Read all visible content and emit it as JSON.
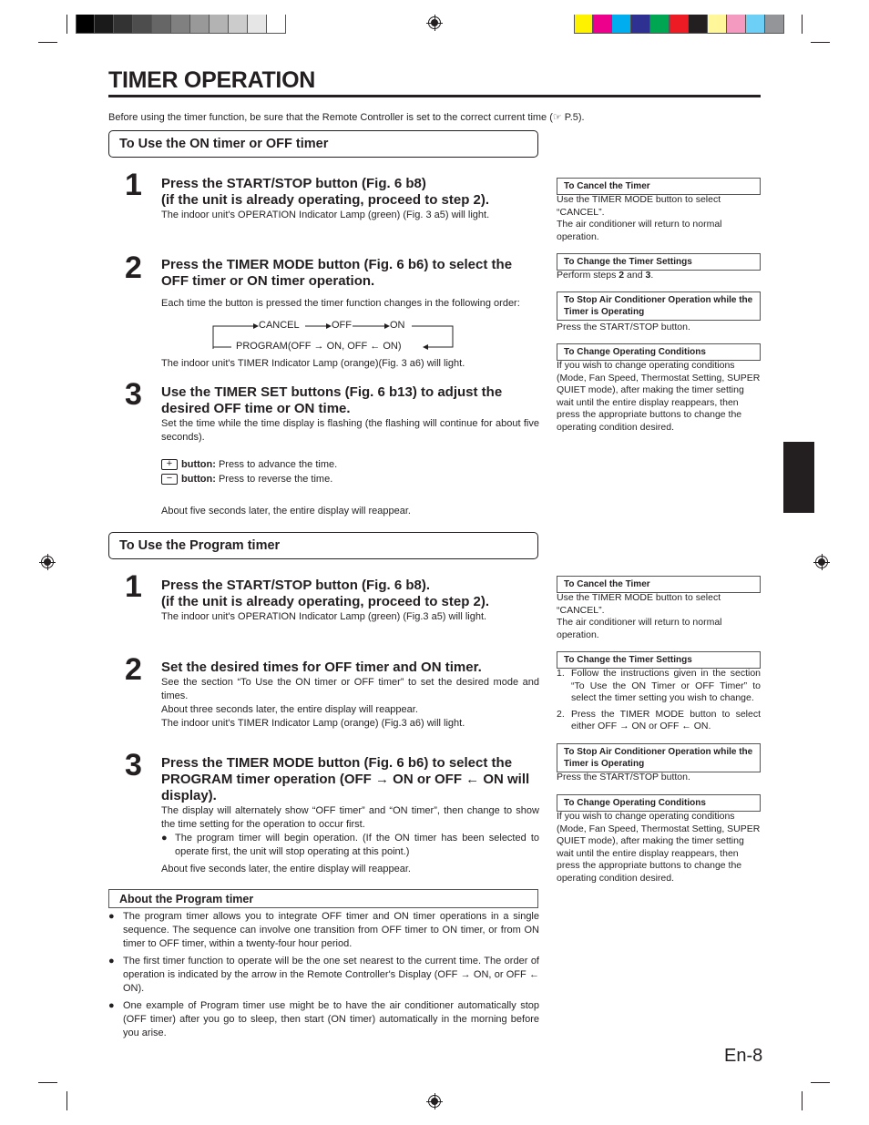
{
  "print_marks": {
    "grayscale_swatches": [
      "#000000",
      "#1a1a1a",
      "#333333",
      "#4d4d4d",
      "#666666",
      "#808080",
      "#999999",
      "#b3b3b3",
      "#cccccc",
      "#e6e6e6",
      "#ffffff"
    ],
    "color_swatches": [
      "#fff200",
      "#ec008c",
      "#00aeef",
      "#2e3192",
      "#00a651",
      "#ed1c24",
      "#231f20",
      "#fff799",
      "#f49ac1",
      "#6dcff6",
      "#939598"
    ]
  },
  "page": {
    "title": "TIMER OPERATION",
    "intro": "Before using the timer function, be sure that the Remote Controller is set to the correct current time (☞ P.5).",
    "page_number": "En-8"
  },
  "section1": {
    "heading": "To Use the ON timer or OFF timer",
    "steps": [
      {
        "num": "1",
        "head": "Press the START/STOP button (Fig. 6 b8) (if the unit is already operating, proceed to step 2).",
        "head_line1": "Press the START/STOP button (Fig. 6 b8)",
        "head_line2": "(if the unit is already operating, proceed to step 2).",
        "body": "The indoor unit's OPERATION Indicator Lamp (green) (Fig. 3 a5) will light."
      },
      {
        "num": "2",
        "head": "Press the TIMER MODE button (Fig. 6 b6) to select the OFF timer or ON timer operation.",
        "body": "Each time the button is pressed the timer function changes in the following order:",
        "flow": {
          "cancel": "CANCEL",
          "off": "OFF",
          "on": "ON",
          "program": "PROGRAM(OFF → ON, OFF ← ON)"
        },
        "body2": "The indoor unit's TIMER Indicator Lamp (orange)(Fig. 3 a6) will light."
      },
      {
        "num": "3",
        "head": "Use the TIMER SET buttons (Fig. 6 b13) to adjust the desired OFF time or ON time.",
        "body": "Set the time while the time display is flashing (the flashing will continue for about five seconds).",
        "plus_key": "+",
        "plus_label": "button:",
        "plus_text": "Press to advance the time.",
        "minus_key": "−",
        "minus_label": "button:",
        "minus_text": "Press to reverse the time.",
        "body2": "About five seconds later, the entire display will reappear."
      }
    ],
    "sidebar": [
      {
        "heading": "To Cancel the Timer",
        "text": "Use the TIMER MODE button to select “CANCEL”.\nThe air conditioner will return to normal operation."
      },
      {
        "heading": "To Change the Timer Settings",
        "text_pre": "Perform steps ",
        "b1": "2",
        "mid": " and ",
        "b2": "3",
        "post": "."
      },
      {
        "heading": "To Stop Air Conditioner Operation while the Timer is Operating",
        "text": "Press the START/STOP button."
      },
      {
        "heading": "To Change Operating Conditions",
        "text": "If you wish to change operating conditions (Mode, Fan Speed, Thermostat Setting, SUPER QUIET mode), after making the timer setting wait until the entire display reappears, then press the appropriate buttons to change the operating condition desired."
      }
    ]
  },
  "section2": {
    "heading": "To Use the Program timer",
    "steps": [
      {
        "num": "1",
        "head_line1": "Press the START/STOP button (Fig. 6 b8).",
        "head_line2": "(if the unit is already operating, proceed to step 2).",
        "body": "The indoor unit's OPERATION Indicator Lamp (green) (Fig.3 a5) will light."
      },
      {
        "num": "2",
        "head": "Set the desired times for OFF timer and ON timer.",
        "body": "See the section “To Use the ON timer or OFF timer” to set the desired mode and times.",
        "body2": "About three seconds later, the entire display will reappear.",
        "body3": "The indoor unit's TIMER Indicator Lamp (orange) (Fig.3 a6) will light."
      },
      {
        "num": "3",
        "head": "Press the TIMER MODE button (Fig. 6 b6) to select the PROGRAM timer operation (OFF → ON or OFF ← ON will display).",
        "body": "The display will alternately show “OFF timer” and “ON timer”, then change to show the time setting for the operation to occur first.",
        "bullet": "The program timer will begin operation. (If the ON timer has been selected to operate first, the unit will stop operating at this point.)",
        "body2": "About five seconds later, the entire display will reappear."
      }
    ],
    "sidebar": [
      {
        "heading": "To Cancel the Timer",
        "text": "Use the TIMER MODE button to select “CANCEL”.\nThe air conditioner will return to normal operation."
      },
      {
        "heading": "To Change the Timer Settings",
        "items": [
          {
            "n": "1.",
            "text": "Follow the instructions given in the section “To Use the ON Timer or OFF Timer” to select the timer setting you wish to change."
          },
          {
            "n": "2.",
            "text": "Press the TIMER MODE button to select either OFF → ON or OFF ← ON."
          }
        ]
      },
      {
        "heading": "To Stop Air Conditioner Operation while the Timer is Operating",
        "text": "Press the START/STOP button."
      },
      {
        "heading": "To Change Operating Conditions",
        "text": "If you wish to change operating conditions (Mode, Fan Speed, Thermostat Setting, SUPER QUIET mode), after making the timer setting wait until the entire display reappears, then press the appropriate buttons to change the operating condition desired."
      }
    ]
  },
  "about": {
    "heading": "About the Program timer",
    "bullets": [
      "The program timer allows you to integrate OFF timer and ON timer operations in a single sequence. The sequence can involve one transition from OFF timer to ON timer, or from ON timer to OFF timer, within a twenty-four hour period.",
      "The first timer function to operate will be the one set nearest to the current time. The order of operation is indicated by the arrow in the Remote Controller's Display (OFF → ON, or OFF ← ON).",
      "One example of Program timer use might be to have the air conditioner automatically stop (OFF timer) after you go to sleep, then start (ON timer) automatically in the morning before you arise."
    ]
  }
}
